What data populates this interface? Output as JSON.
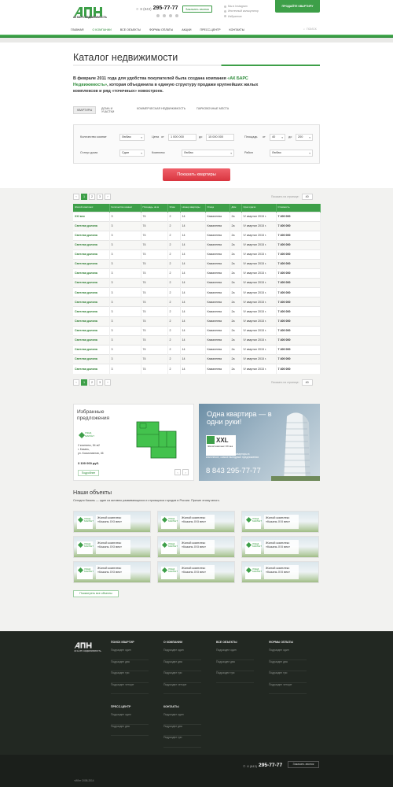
{
  "header": {
    "logo_text": "АДН",
    "logo_sub": "АК БАРС НЕДВИЖИМОСТЬ",
    "phone_prefix": "8 (843)",
    "phone_number": "295-77-77",
    "callback_label": "Заказать звонок",
    "links": [
      "Мы в Instagram",
      "Ипотечный калькулятор",
      "Избранное"
    ],
    "sell_label": "ПРОДАЙТЕ КВАРТИРУ",
    "nav": [
      "ГЛАВНАЯ",
      "О КОМПАНИИ",
      "ВСЕ ОБЪЕКТЫ",
      "ФОРМЫ ОПЛАТЫ",
      "АКЦИИ",
      "ПРЕСС-ЦЕНТР",
      "КОНТАКТЫ"
    ],
    "nav_active_index": 1,
    "search_label": "ПОИСК",
    "colors": {
      "brand": "#3d9f48",
      "accent": "#e0434c"
    }
  },
  "page": {
    "title": "Каталог недвижимости",
    "intro_pre": "В феврале 2011 года для удобства покупателей была создана компания ",
    "intro_link": "«АК БАРС Недвижимость»",
    "intro_post": ", которая объединила в единую структуру продажи крупнейших жилых комплексов и ряд «точечных» новостроек."
  },
  "tabs": [
    "КВАРТИРЫ",
    "ДОМА И УЧАСТКИ",
    "КОММЕРЧЕСКАЯ НЕДВИЖИМОСТЬ",
    "ПАРКОВОЧНЫЕ МЕСТА"
  ],
  "filters": {
    "rooms_label": "Количество комнат",
    "rooms_value": "Любая",
    "price_label": "Цена",
    "price_from_label": "от",
    "price_from": "1 000 000",
    "price_to_label": "до",
    "price_to": "15 000 000",
    "area_label": "Площадь",
    "area_from_label": "от",
    "area_from": "40",
    "area_to_label": "до",
    "area_to": "200",
    "status_label": "Статус дома",
    "status_value": "Сдан",
    "complex_label": "Комплекс",
    "complex_value": "Любая",
    "district_label": "Район",
    "district_value": "Любая",
    "submit_label": "Показать квартиры"
  },
  "pagination": {
    "pages": [
      "1",
      "2",
      "3"
    ],
    "active": "1",
    "prev": "‹",
    "next": "›",
    "per_page_label": "Показать на странице:",
    "per_page_value": "40"
  },
  "table": {
    "columns": [
      "Жилой комплекс",
      "Количество комнат",
      "Площадь, кв.м",
      "Этаж",
      "Номер квартиры",
      "Улица",
      "Дом",
      "Срок сдачи",
      "Стоимость"
    ],
    "rows": [
      [
        "XXI век",
        "3",
        "74",
        "2",
        "14",
        "Камалеева",
        "2а",
        "IV квартал 2015 г.",
        "7 400 000"
      ],
      [
        "Светлая долина",
        "3",
        "74",
        "2",
        "14",
        "Камалеева",
        "2а",
        "IV квартал 2015 г.",
        "7 400 000"
      ],
      [
        "Светлая долина",
        "3",
        "74",
        "2",
        "14",
        "Камалеева",
        "2а",
        "IV квартал 2015 г.",
        "7 400 000"
      ],
      [
        "Светлая долина",
        "3",
        "74",
        "2",
        "14",
        "Камалеева",
        "2а",
        "IV квартал 2015 г.",
        "7 400 000"
      ],
      [
        "Светлая долина",
        "3",
        "74",
        "2",
        "14",
        "Камалеева",
        "2а",
        "IV квартал 2015 г.",
        "7 400 000"
      ],
      [
        "Светлая долина",
        "3",
        "74",
        "2",
        "14",
        "Камалеева",
        "2а",
        "IV квартал 2015 г.",
        "7 400 000"
      ],
      [
        "Светлая долина",
        "3",
        "74",
        "2",
        "14",
        "Камалеева",
        "2а",
        "IV квартал 2015 г.",
        "7 400 000"
      ],
      [
        "Светлая долина",
        "3",
        "74",
        "2",
        "14",
        "Камалеева",
        "2а",
        "IV квартал 2015 г.",
        "7 400 000"
      ],
      [
        "Светлая долина",
        "3",
        "74",
        "2",
        "14",
        "Камалеева",
        "2а",
        "IV квартал 2015 г.",
        "7 400 000"
      ],
      [
        "Светлая долина",
        "3",
        "74",
        "2",
        "14",
        "Камалеева",
        "2а",
        "IV квартал 2015 г.",
        "7 400 000"
      ],
      [
        "Светлая долина",
        "3",
        "74",
        "2",
        "14",
        "Камалеева",
        "2а",
        "IV квартал 2015 г.",
        "7 400 000"
      ],
      [
        "Светлая долина",
        "3",
        "74",
        "2",
        "14",
        "Камалеева",
        "2а",
        "IV квартал 2015 г.",
        "7 400 000"
      ],
      [
        "Светлая долина",
        "3",
        "74",
        "2",
        "14",
        "Камалеева",
        "2а",
        "IV квартал 2015 г.",
        "7 400 000"
      ],
      [
        "Светлая долина",
        "3",
        "74",
        "2",
        "14",
        "Камалеева",
        "2а",
        "IV квартал 2015 г.",
        "7 400 000"
      ],
      [
        "Светлая долина",
        "3",
        "74",
        "2",
        "14",
        "Камалеева",
        "2а",
        "IV квартал 2015 г.",
        "7 400 000"
      ],
      [
        "Светлая долина",
        "3",
        "74",
        "2",
        "14",
        "Камалеева",
        "2а",
        "IV квартал 2015 г.",
        "7 400 000"
      ],
      [
        "Светлая долина",
        "3",
        "74",
        "2",
        "14",
        "Камалеева",
        "2а",
        "IV квартал 2015 г.",
        "7 400 000"
      ]
    ]
  },
  "promo_left": {
    "title": "Избранные предложения",
    "logo_text": "ЛЭНД МАРКЕТ",
    "desc_line1": "2 комнаты, 54 м2",
    "desc_line2": "г. Казань,",
    "desc_line3": "ул. Космонавтов, 46",
    "price": "3 100 000 руб.",
    "more_label": "Подробнее"
  },
  "promo_right": {
    "title": "Одна квартира — в одни руки!",
    "brand": "XXL",
    "brand_sub": "Жилой комплекс XXI век",
    "desc": "Отличная рассрочка на квартиры в комплексе, самые выгодные предложения",
    "phone": "8 843 295-77-77"
  },
  "objects": {
    "title": "Наши объекты",
    "subtitle": "Сегодня Казань — один из активно развивающихся и строящихся городов в России. Причин этому много.",
    "card_logo": "ЛЭНД МАРКЕТ",
    "cards": [
      "Жилой комплекс «Казань XXI век»",
      "Жилой комплекс «Казань XXI век»",
      "Жилой комплекс «Казань XXI век»",
      "Жилой комплекс «Казань XXI век»",
      "Жилой комплекс «Казань XXI век»",
      "Жилой комплекс «Казань XXI век»",
      "Жилой комплекс «Казань XXI век»",
      "Жилой комплекс «Казань XXI век»",
      "Жилой комплекс «Казань XXI век»"
    ],
    "show_all_label": "Посмотреть все объекты"
  },
  "footer": {
    "logo_text": "АДН",
    "logo_sub": "АК БАРС НЕДВИЖИМОСТЬ",
    "col1": {
      "title": "ПОИСК КВАРТИР",
      "items": [
        "Подраздел один",
        "Подраздел два",
        "Подраздел три",
        "Подраздел четыре"
      ]
    },
    "col2": {
      "title": "О КОМПАНИИ",
      "items": [
        "Подраздел один",
        "Подраздел два",
        "Подраздел три",
        "Подраздел четыре"
      ]
    },
    "col3": {
      "title": "ВСЕ ОБЪЕКТЫ",
      "items": [
        "Подраздел один",
        "Подраздел два",
        "Подраздел три"
      ]
    },
    "col4": {
      "title": "ФОРМЫ ОПЛАТЫ",
      "items": [
        "Подраздел один",
        "Подраздел два",
        "Подраздел три",
        "Подраздел четыре"
      ]
    },
    "col5": {
      "title": "ПРЕСС-ЦЕНТР",
      "items": [
        "Подраздел один",
        "Подраздел два"
      ]
    },
    "col6": {
      "title": "КОНТАКТЫ",
      "items": [
        "Подраздел один",
        "Подраздел два",
        "Подраздел три"
      ]
    },
    "phone_prefix": "8 (843)",
    "phone_number": "295-77-77",
    "callback_label": "Заказать звонок",
    "copyright": "«Ибн» 2008-2014"
  }
}
